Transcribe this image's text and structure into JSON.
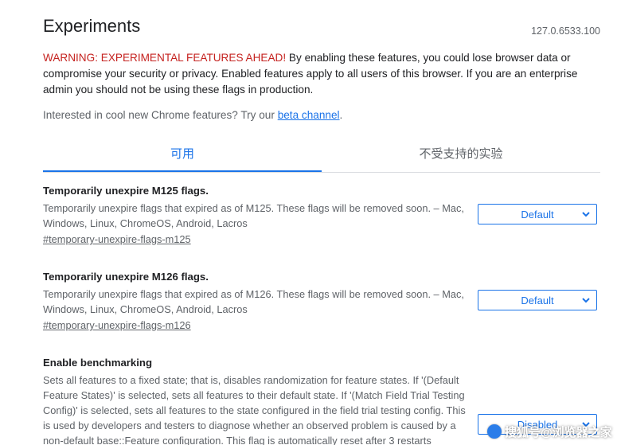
{
  "header": {
    "title": "Experiments",
    "version": "127.0.6533.100"
  },
  "warning": {
    "highlight": "WARNING: EXPERIMENTAL FEATURES AHEAD!",
    "text": " By enabling these features, you could lose browser data or compromise your security or privacy. Enabled features apply to all users of this browser. If you are an enterprise admin you should not be using these flags in production."
  },
  "promo": {
    "text": "Interested in cool new Chrome features? Try our ",
    "link": "beta channel",
    "suffix": "."
  },
  "tabs": [
    {
      "label": "可用",
      "active": true
    },
    {
      "label": "不受支持的实验",
      "active": false
    }
  ],
  "flags": [
    {
      "name": "Temporarily unexpire M125 flags.",
      "description": "Temporarily unexpire flags that expired as of M125. These flags will be removed soon. – Mac, Windows, Linux, ChromeOS, Android, Lacros",
      "link": "#temporary-unexpire-flags-m125",
      "value": "Default"
    },
    {
      "name": "Temporarily unexpire M126 flags.",
      "description": "Temporarily unexpire flags that expired as of M126. These flags will be removed soon. – Mac, Windows, Linux, ChromeOS, Android, Lacros",
      "link": "#temporary-unexpire-flags-m126",
      "value": "Default"
    },
    {
      "name": "Enable benchmarking",
      "description": "Sets all features to a fixed state; that is, disables randomization for feature states. If '(Default Feature States)' is selected, sets all features to their default state. If '(Match Field Trial Testing Config)' is selected, sets all features to the state configured in the field trial testing config. This is used by developers and testers to diagnose whether an observed problem is caused by a non-default base::Feature configuration. This flag is automatically reset after 3 restarts",
      "value": "Disabled"
    }
  ],
  "watermark": "搜狐号@浏览器之家",
  "colors": {
    "accent": "#1a73e8",
    "warning": "#c5221f",
    "secondary_text": "#5f6368"
  }
}
